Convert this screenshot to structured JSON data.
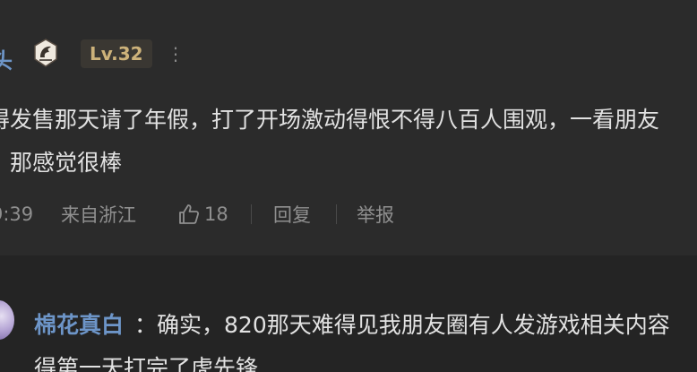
{
  "comment": {
    "username_fragment": "头",
    "badge_icon": "dragon-badge-icon",
    "level": "Lv.32",
    "more": "⋮",
    "text_line1": "得发售那天请了年假，打了开场激动得恨不得八百人围观，一看朋友",
    "text_line2": "，那感觉很棒",
    "time": "9:39",
    "location": "来自浙江",
    "likes": "18",
    "reply_label": "回复",
    "report_label": "举报"
  },
  "reply": {
    "username": "棉花真白",
    "text": "：确实，820那天难得见我朋友圈有人发游戏相关内容",
    "text_line2": "得第一天打完了虎先锋"
  },
  "colors": {
    "background": "#2b2b2b",
    "reply_background": "#242424",
    "username": "#6d95c8",
    "level_text": "#cdb27a",
    "meta_text": "#8f8f8f"
  }
}
